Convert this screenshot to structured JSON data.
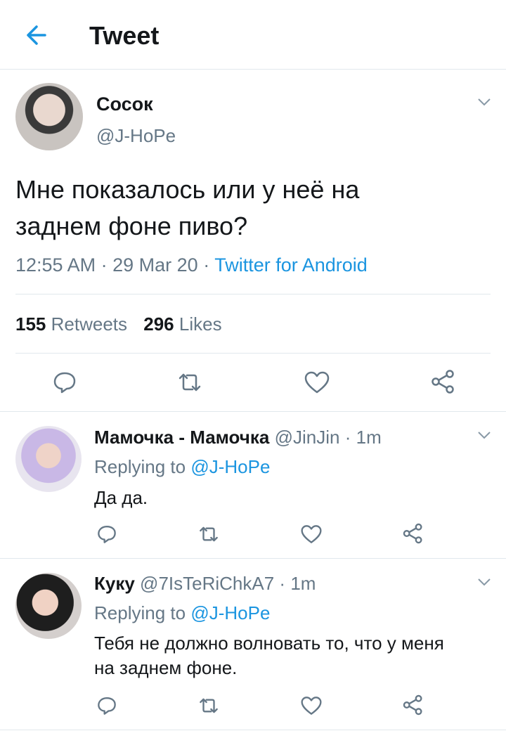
{
  "header": {
    "title": "Tweet"
  },
  "tweet": {
    "display_name": "Сосок",
    "handle": "@J-HoPe",
    "text_line1": "Мне показалось или у неё на",
    "text_line2": "заднем фоне пиво?",
    "time": "12:55 AM",
    "date": "29 Mar 20",
    "source": "Twitter for Android",
    "retweets_count": "155",
    "retweets_label": "Retweets",
    "likes_count": "296",
    "likes_label": "Likes"
  },
  "replies": [
    {
      "display_name": "Мамочка - Мамочка",
      "handle": "@JinJin",
      "time": "1m",
      "replying_label": "Replying to",
      "replying_to": "@J-HoPe",
      "text_line1": "Да да.",
      "text_line2": ""
    },
    {
      "display_name": "Куку",
      "handle": "@7IsTeRiChkA7",
      "time": "1m",
      "replying_label": "Replying to",
      "replying_to": "@J-HoPe",
      "text_line1": "Тебя не должно волновать то, что у меня",
      "text_line2": "на заднем фоне."
    }
  ],
  "colors": {
    "accent": "#1b95e0",
    "muted": "#657786",
    "divider": "#e1e8ed"
  },
  "icons": [
    "back-arrow-icon",
    "chevron-down-icon",
    "reply-icon",
    "retweet-icon",
    "like-icon",
    "share-icon"
  ]
}
